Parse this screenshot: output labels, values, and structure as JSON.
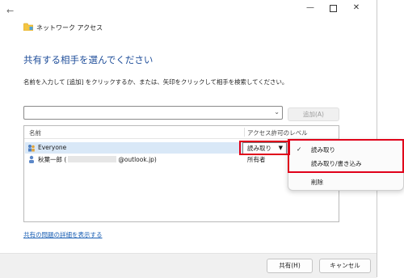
{
  "window": {
    "title": "ネットワーク アクセス",
    "controls": {
      "minimize": "—",
      "maximize": "",
      "close": "✕"
    }
  },
  "page": {
    "heading": "共有する相手を選んでください",
    "instruction": "名前を入力して [追加] をクリックするか、または、矢印をクリックして相手を検索してください。"
  },
  "name_input": {
    "value": "",
    "arrow": "⌄"
  },
  "add_button": {
    "label": "追加(A)"
  },
  "share_list": {
    "columns": {
      "name": "名前",
      "level": "アクセス許可のレベル"
    },
    "rows": [
      {
        "icon": "group-icon",
        "name": "Everyone",
        "level": "読み取り",
        "selected": true
      },
      {
        "icon": "user-icon",
        "name_prefix": "秋葉一郎 (",
        "name_suffix": "@outlook.jp)",
        "level": "所有者",
        "selected": false
      }
    ]
  },
  "context_menu": {
    "items": [
      {
        "label": "読み取り",
        "checked": true,
        "check_mark": "✓"
      },
      {
        "label": "読み取り/書き込み",
        "checked": false
      },
      {
        "label": "削除",
        "checked": false
      }
    ]
  },
  "help_link": "共有の問題の詳細を表示する",
  "footer": {
    "share_label": "共有(H)",
    "cancel_label": "キャンセル"
  },
  "colors": {
    "heading": "#1f4e9a",
    "highlight": "#e0001a",
    "selected_row": "#d9e8f7",
    "link": "#1a5fb4"
  }
}
